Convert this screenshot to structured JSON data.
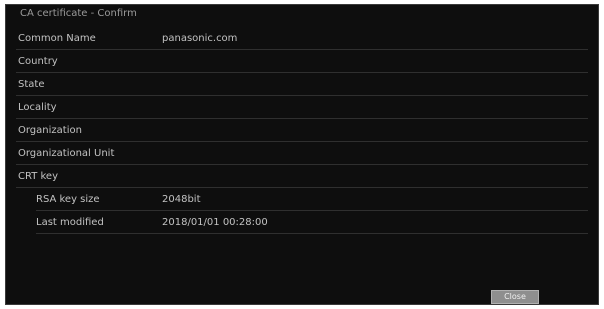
{
  "dialog": {
    "title": "CA certificate - Confirm"
  },
  "fields": [
    {
      "label": "Common Name",
      "value": "panasonic.com"
    },
    {
      "label": "Country",
      "value": ""
    },
    {
      "label": "State",
      "value": ""
    },
    {
      "label": "Locality",
      "value": ""
    },
    {
      "label": "Organization",
      "value": ""
    },
    {
      "label": "Organizational Unit",
      "value": ""
    },
    {
      "label": "CRT key",
      "value": ""
    }
  ],
  "crt_key": {
    "rsa_label": "RSA key size",
    "rsa_value": "2048bit",
    "modified_label": "Last modified",
    "modified_value": "2018/01/01 00:28:00"
  },
  "close_button": {
    "label": "Close"
  }
}
